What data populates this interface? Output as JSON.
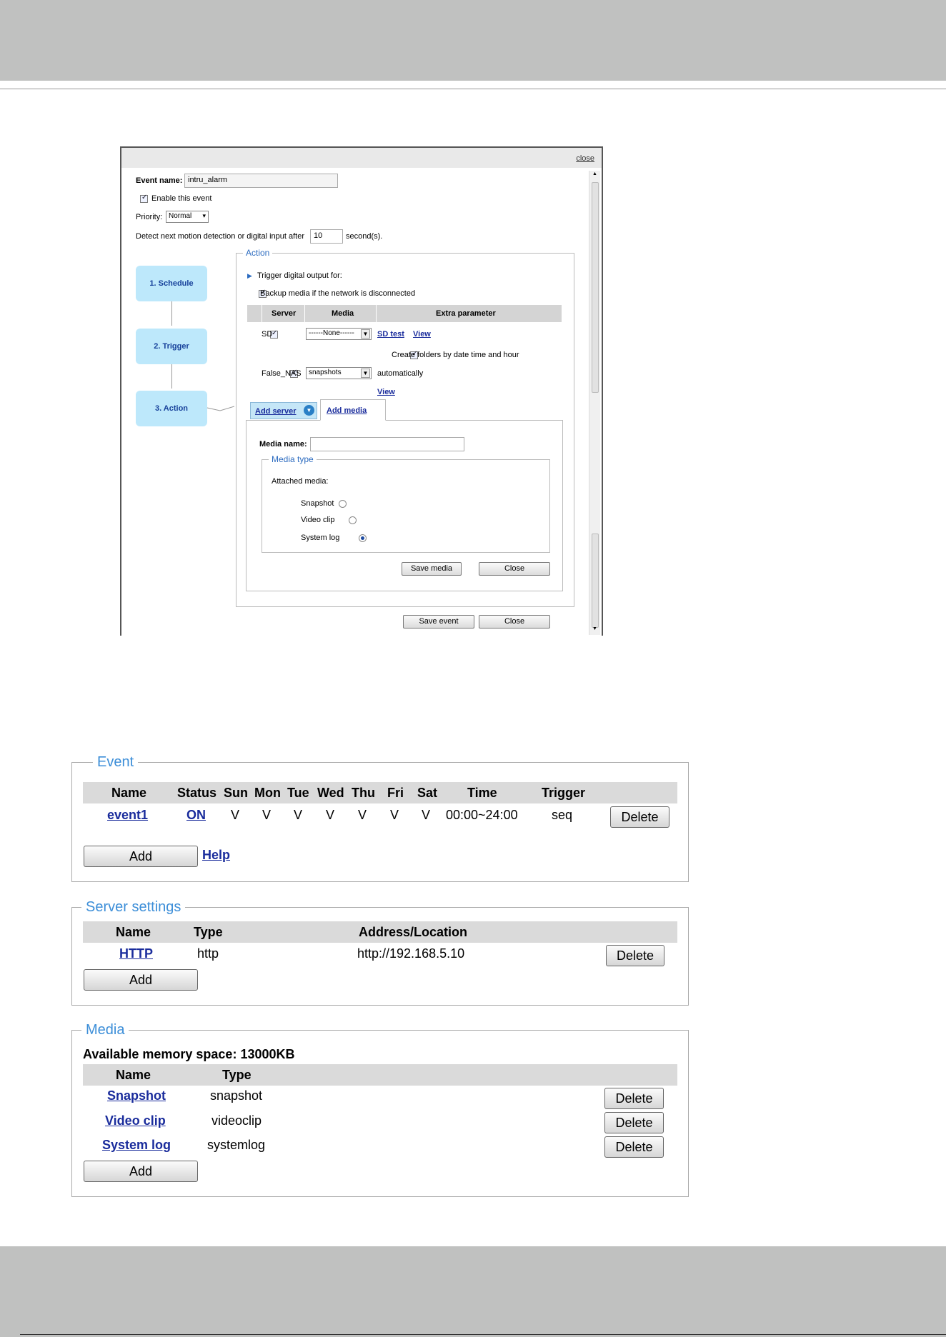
{
  "dialog": {
    "close": "close",
    "event_name_label": "Event name:",
    "event_name_value": "intru_alarm",
    "enable_label": "Enable this event",
    "priority_label": "Priority:",
    "priority_value": "Normal",
    "detect_prefix": "Detect next motion detection or digital input after",
    "detect_value": "10",
    "detect_suffix": "second(s).",
    "steps": [
      "1.  Schedule",
      "2.  Trigger",
      "3.  Action"
    ],
    "action": {
      "legend": "Action",
      "trigger_output": "Trigger digital output for:",
      "backup_label": "Backup media if the network is disconnected",
      "headers": [
        "Server",
        "Media",
        "Extra parameter"
      ],
      "rows": [
        {
          "server": "SD",
          "media": "------None------",
          "link1": "SD test",
          "link2": "View",
          "option": "Create folders by date time and hour"
        },
        {
          "server": "False_NAS",
          "media": "snapshots",
          "extra": "automatically",
          "link2": "View"
        }
      ],
      "tab_add_server": "Add server",
      "tab_add_media": "Add media",
      "media_name_label": "Media name:",
      "media_type_legend": "Media type",
      "attached_media": "Attached media:",
      "radio_options": [
        "Snapshot",
        "Video clip",
        "System log"
      ],
      "radio_selected": "System log",
      "save_media": "Save media",
      "close_media": "Close"
    },
    "save_event": "Save event",
    "close_event": "Close"
  },
  "event_panel": {
    "legend": "Event",
    "headers": [
      "Name",
      "Status",
      "Sun",
      "Mon",
      "Tue",
      "Wed",
      "Thu",
      "Fri",
      "Sat",
      "Time",
      "Trigger"
    ],
    "row": {
      "name": "event1",
      "status": "ON",
      "sun": "V",
      "mon": "V",
      "tue": "V",
      "wed": "V",
      "thu": "V",
      "fri": "V",
      "sat": "V",
      "time": "00:00~24:00",
      "trigger": "seq"
    },
    "delete": "Delete",
    "add": "Add",
    "help": "Help"
  },
  "server_panel": {
    "legend": "Server settings",
    "headers": [
      "Name",
      "Type",
      "Address/Location"
    ],
    "row": {
      "name": "HTTP",
      "type": "http",
      "address": "http://192.168.5.10"
    },
    "delete": "Delete",
    "add": "Add"
  },
  "media_panel": {
    "legend": "Media",
    "memory": "Available memory space: 13000KB",
    "headers": [
      "Name",
      "Type"
    ],
    "rows": [
      {
        "name": "Snapshot",
        "type": "snapshot"
      },
      {
        "name": "Video clip",
        "type": "videoclip"
      },
      {
        "name": "System log",
        "type": "systemlog"
      }
    ],
    "delete": "Delete",
    "add": "Add"
  }
}
